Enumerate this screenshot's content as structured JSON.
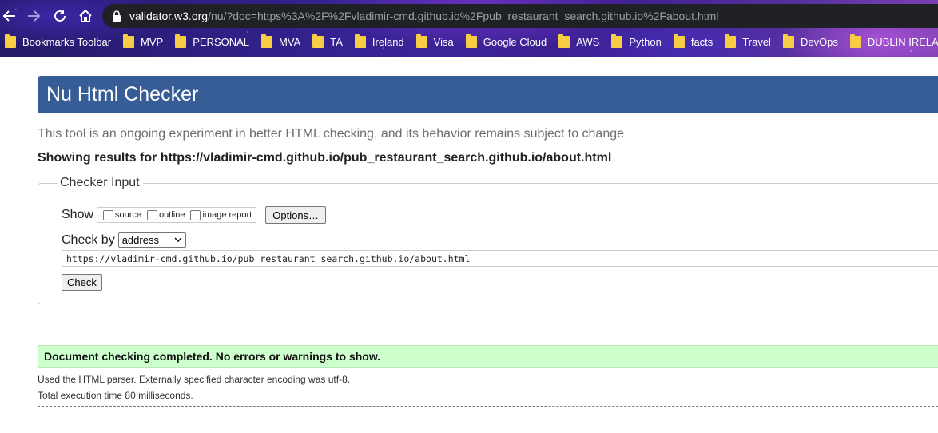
{
  "browser": {
    "url_host": "validator.w3.org",
    "url_path": "/nu/?doc=https%3A%2F%2Fvladimir-cmd.github.io%2Fpub_restaurant_search.github.io%2Fabout.html",
    "bookmarks": [
      "Bookmarks Toolbar",
      "MVP",
      "PERSONAL",
      "MVA",
      "TA",
      "Ireland",
      "Visa",
      "Google Cloud",
      "AWS",
      "Python",
      "facts",
      "Travel",
      "DevOps",
      "DUBLIN IRELAND"
    ]
  },
  "page": {
    "title": "Nu Html Checker",
    "tagline": "This tool is an ongoing experiment in better HTML checking, and its behavior remains subject to change",
    "results_for": "Showing results for https://vladimir-cmd.github.io/pub_restaurant_search.github.io/about.html"
  },
  "checker_input": {
    "legend": "Checker Input",
    "show_label": "Show",
    "show_options": [
      {
        "label": "source",
        "checked": false
      },
      {
        "label": "outline",
        "checked": false
      },
      {
        "label": "image report",
        "checked": false
      }
    ],
    "options_button": "Options…",
    "check_by_label": "Check by",
    "check_by_value": "address",
    "url_value": "https://vladimir-cmd.github.io/pub_restaurant_search.github.io/about.html",
    "check_button": "Check"
  },
  "result": {
    "status": "Document checking completed. No errors or warnings to show.",
    "parser_info": "Used the HTML parser. Externally specified character encoding was utf-8.",
    "execution_time": "Total execution time 80 milliseconds."
  },
  "colors": {
    "banner": "#365d95",
    "success_bg": "#ccffcc",
    "folder": "#f7cd46"
  }
}
